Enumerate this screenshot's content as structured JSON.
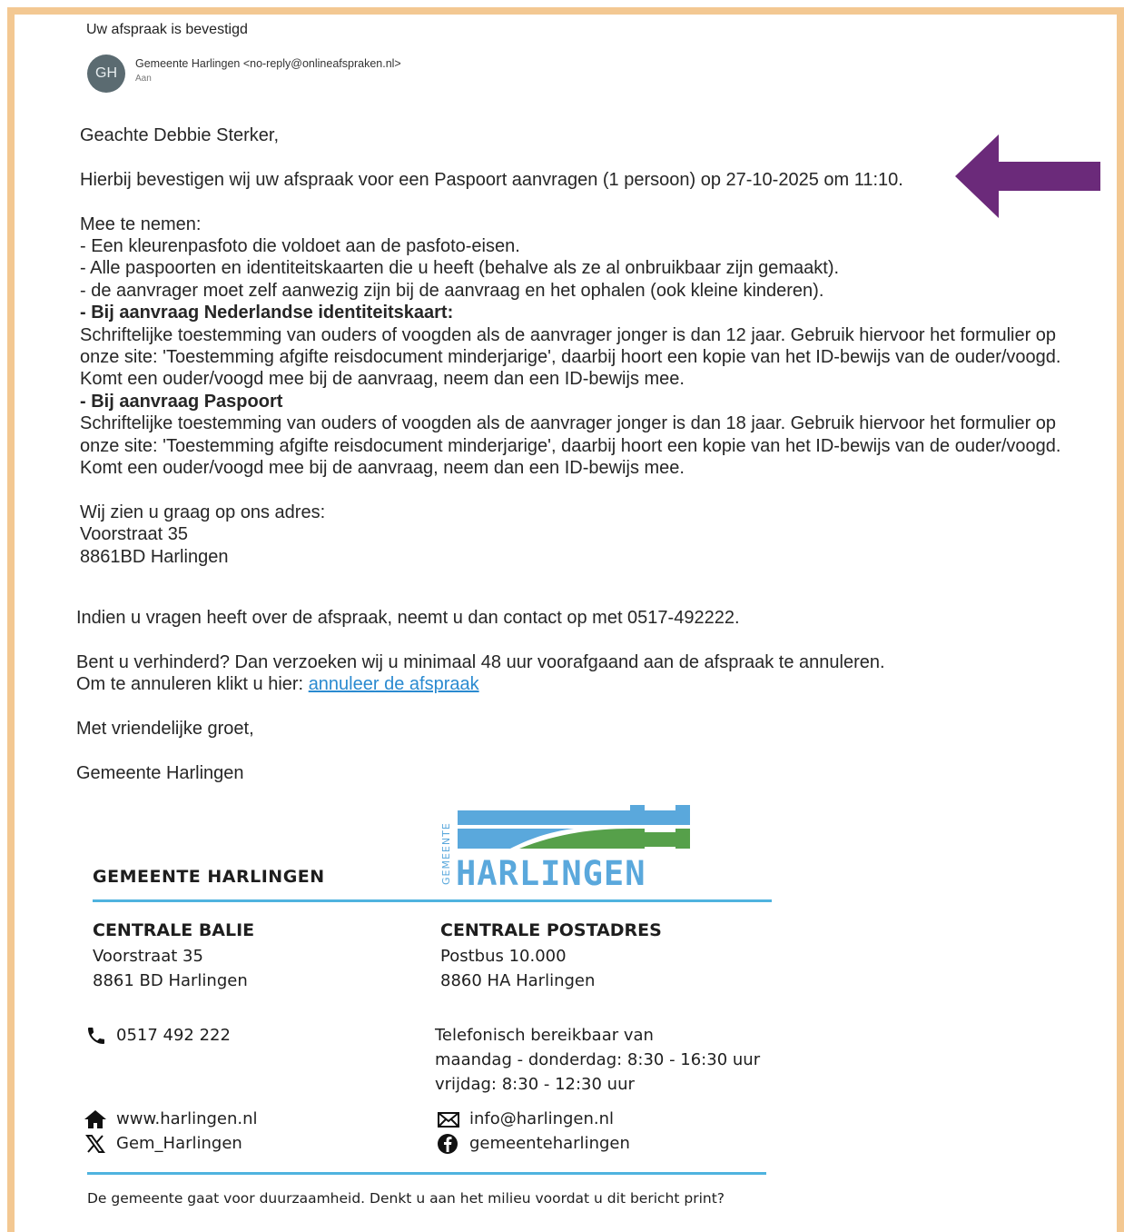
{
  "email": {
    "subject": "Uw afspraak is bevestigd",
    "avatar_initials": "GH",
    "sender": "Gemeente Harlingen <no-reply@onlineafspraken.nl>",
    "to_label": "Aan"
  },
  "body": {
    "greeting": "Geachte Debbie Sterker,",
    "confirmation": "Hierbij bevestigen wij uw afspraak voor een Paspoort aanvragen (1 persoon) op 27-10-2025 om 11:10.",
    "bring_heading": "Mee te nemen:",
    "bring_items": [
      "- Een kleurenpasfoto die voldoet aan de pasfoto-eisen.",
      "- Alle paspoorten en identiteitskaarten die u heeft (behalve als ze al onbruikbaar zijn gemaakt).",
      "- de aanvrager moet zelf aanwezig zijn bij de aanvraag en het ophalen (ook kleine kinderen)."
    ],
    "id_heading": "-  Bij aanvraag Nederlandse identiteitskaart:",
    "id_text": "Schriftelijke toestemming van ouders of voogden als de aanvrager jonger is dan 12 jaar. Gebruik hiervoor het formulier op onze site: 'Toestemming afgifte reisdocument minderjarige', daarbij hoort een kopie van het ID-bewijs van de ouder/voogd. Komt een ouder/voogd mee bij de aanvraag, neem dan een ID-bewijs mee.",
    "passport_heading": "- Bij aanvraag Paspoort",
    "passport_text": "Schriftelijke toestemming van ouders of voogden als de aanvrager jonger is dan 18 jaar. Gebruik hiervoor het formulier op onze site: 'Toestemming afgifte reisdocument minderjarige', daarbij hoort een kopie van het ID-bewijs van de ouder/voogd. Komt een ouder/voogd mee bij de aanvraag, neem dan een ID-bewijs mee.",
    "address_intro": "Wij zien u graag op ons adres:",
    "address_street": "Voorstraat 35",
    "address_city": "8861BD Harlingen",
    "questions": "Indien u vragen heeft over de afspraak, neemt u dan contact op met 0517-492222.",
    "cancel_text": "Bent u verhinderd? Dan verzoeken wij u minimaal 48 uur voorafgaand aan de afspraak te annuleren.",
    "cancel_link_prefix": "Om te annuleren klikt u hier: ",
    "cancel_link": "annuleer de afspraak",
    "closing": "Met vriendelijke groet,",
    "signature_name": "Gemeente Harlingen"
  },
  "signature": {
    "org": "GEMEENTE HARLINGEN",
    "logo_small": "GEMEENTE",
    "logo_big": "HARLINGEN",
    "balie_heading": "CENTRALE BALIE",
    "balie_street": "Voorstraat 35",
    "balie_city": "8861 BD Harlingen",
    "post_heading": "CENTRALE POSTADRES",
    "post_box": "Postbus 10.000",
    "post_city": "8860 HA Harlingen",
    "phone": "0517 492 222",
    "hours_title": "Telefonisch bereikbaar van",
    "hours_weekdays": "maandag - donderdag: 8:30 - 16:30 uur",
    "hours_friday": "vrijdag: 8:30 - 12:30 uur",
    "website": "www.harlingen.nl",
    "x_handle": "Gem_Harlingen",
    "email": "info@harlingen.nl",
    "facebook": "gemeenteharlingen",
    "footer_note": "De gemeente gaat voor duurzaamheid. Denkt u aan het milieu voordat u dit bericht print?"
  },
  "colors": {
    "frame": "#f3c892",
    "arrow": "#6b2a7a",
    "link": "#2a8ad0",
    "logo_blue": "#5aa8dc",
    "logo_green": "#56a04a",
    "rule": "#4fb3df"
  }
}
